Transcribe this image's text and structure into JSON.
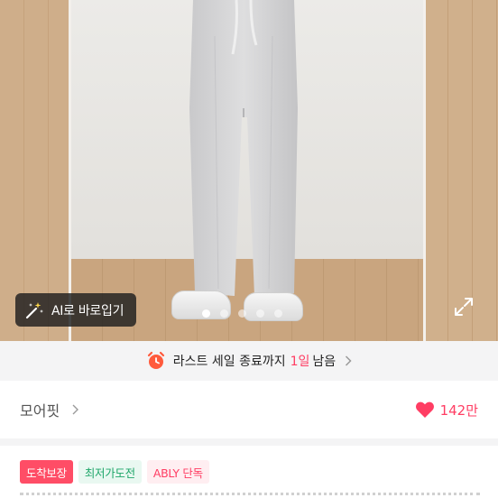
{
  "photo": {
    "ai_button_label": "AI로 바로입기",
    "carousel": {
      "total": 5,
      "active_index": 0
    },
    "icons": {
      "ai": "magic-wand-icon",
      "expand": "expand-icon"
    }
  },
  "sale_banner": {
    "label": "라스트 세일 종료까지",
    "highlight": "1일",
    "suffix": "남음",
    "icon": "alarm-clock-icon"
  },
  "store": {
    "name": "모어핏",
    "like_count": "142만",
    "like_color": "#ff3d63"
  },
  "badges": [
    {
      "label": "도착보장",
      "style": "red"
    },
    {
      "label": "최저가도전",
      "style": "green"
    },
    {
      "label": "ABLY 단독",
      "style": "pink"
    }
  ],
  "colors": {
    "accent": "#ff3d63",
    "green": "#1fa66a",
    "banner_bg": "#f4f4f5"
  }
}
